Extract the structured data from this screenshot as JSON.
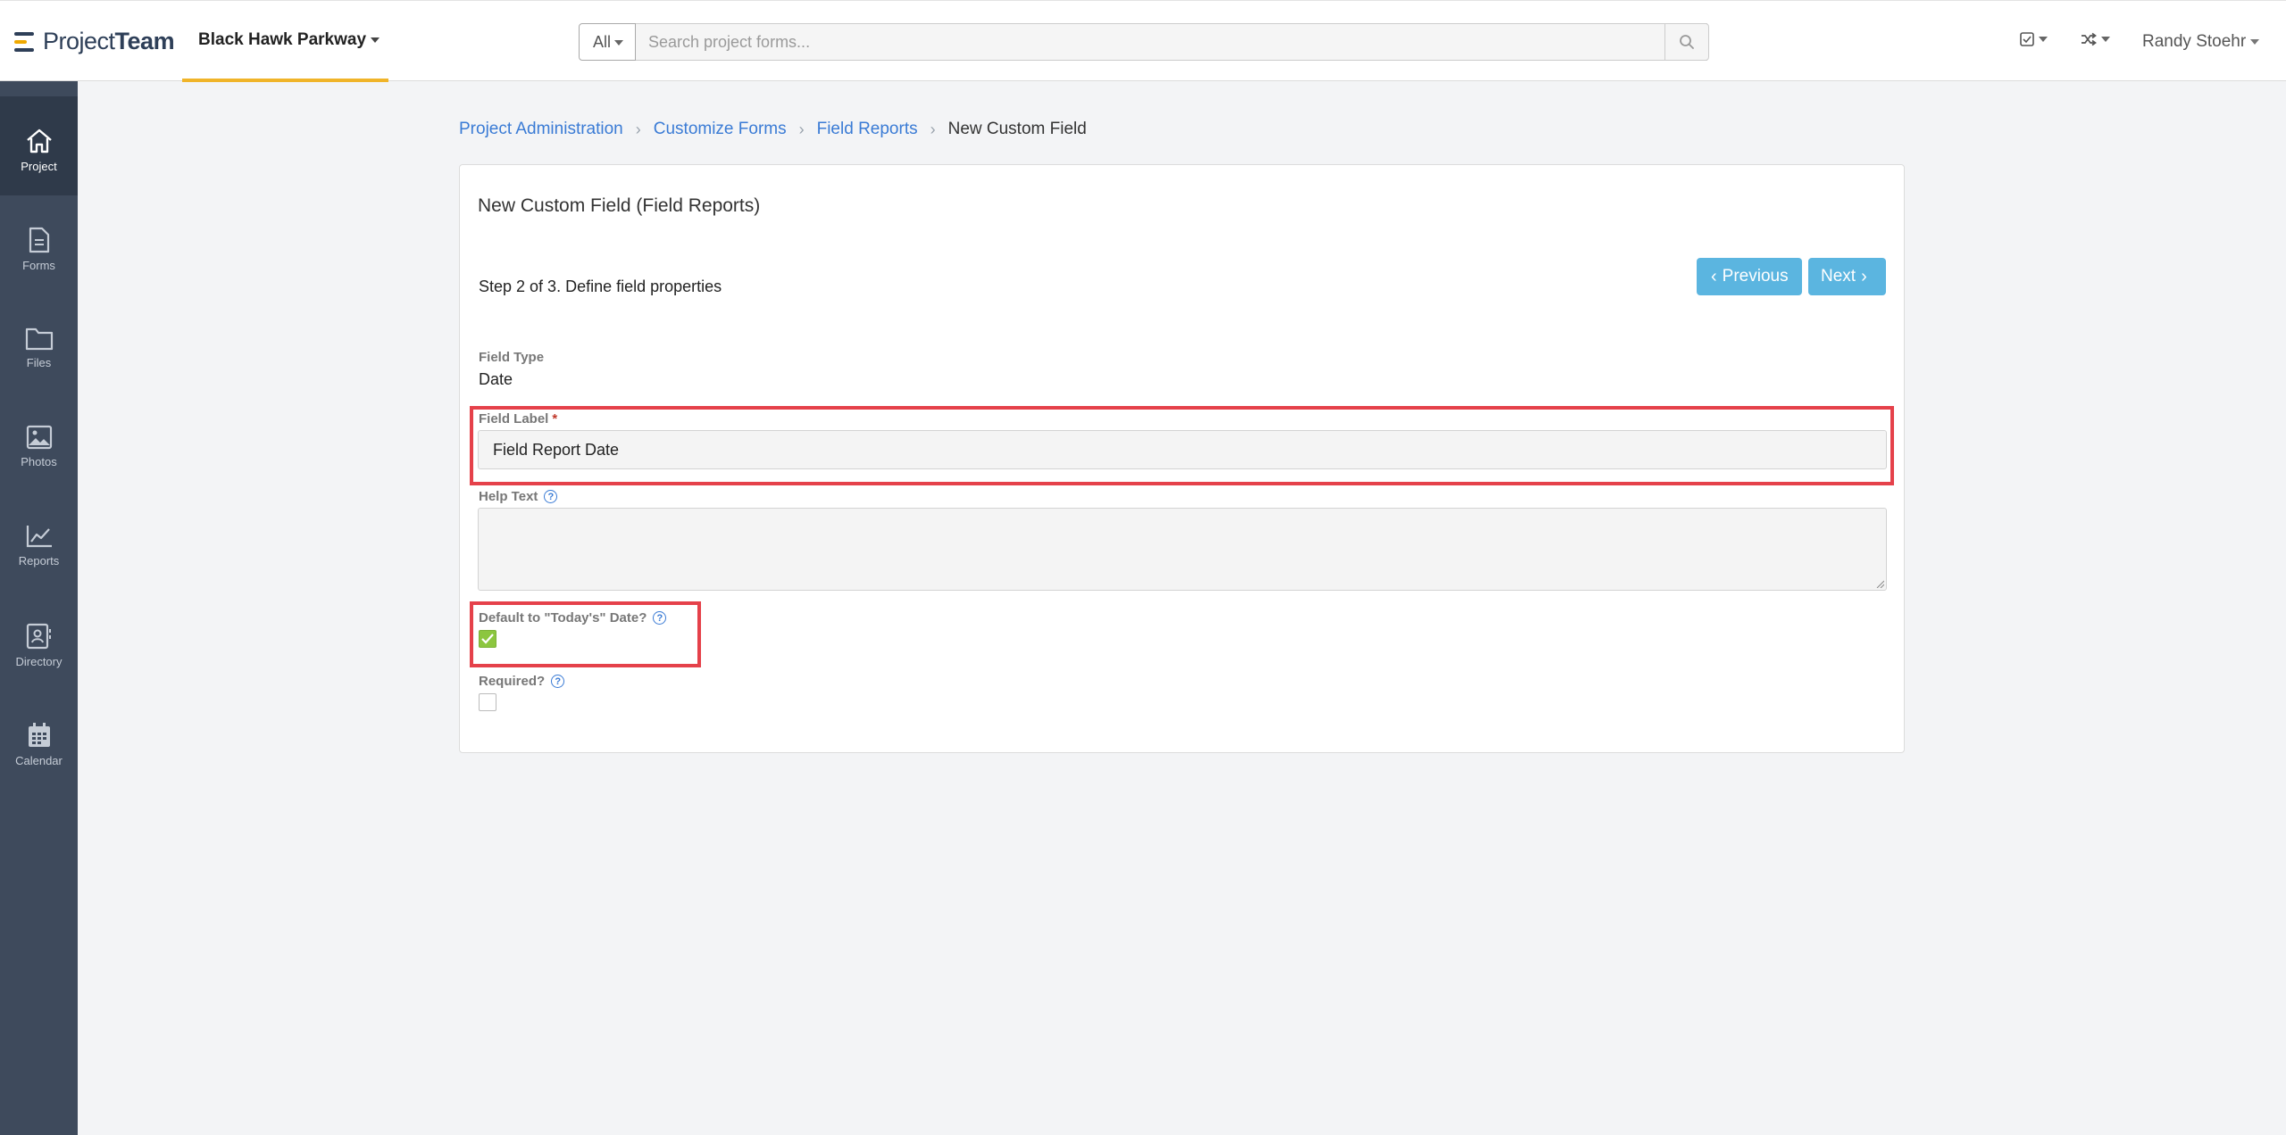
{
  "header": {
    "logo_text_light": "Project",
    "logo_text_bold": "Team",
    "project_name": "Black Hawk Parkway",
    "search": {
      "scope": "All",
      "placeholder": "Search project forms..."
    },
    "user_name": "Randy Stoehr"
  },
  "sidebar": {
    "items": [
      {
        "label": "Project",
        "icon": "home-icon",
        "active": true
      },
      {
        "label": "Forms",
        "icon": "document-icon"
      },
      {
        "label": "Files",
        "icon": "folder-icon"
      },
      {
        "label": "Photos",
        "icon": "image-icon"
      },
      {
        "label": "Reports",
        "icon": "chart-icon"
      },
      {
        "label": "Directory",
        "icon": "contact-book-icon"
      },
      {
        "label": "Calendar",
        "icon": "calendar-icon"
      }
    ]
  },
  "breadcrumb": {
    "items": [
      "Project Administration",
      "Customize Forms",
      "Field Reports"
    ],
    "current": "New Custom Field"
  },
  "card": {
    "title": "New Custom Field (Field Reports)",
    "step": "Step 2 of 3. Define field properties",
    "previous_label": "Previous",
    "next_label": "Next",
    "field_type_label": "Field Type",
    "field_type_value": "Date",
    "field_label_label": "Field Label",
    "field_label_required_mark": "*",
    "field_label_value": "Field Report Date",
    "help_text_label": "Help Text",
    "help_text_value": "",
    "default_today_label": "Default to \"Today's\" Date?",
    "default_today_checked": true,
    "required_label": "Required?",
    "required_checked": false
  },
  "colors": {
    "accent_blue": "#3a7bd5",
    "button_blue": "#5bb5e0",
    "sidebar_bg": "#3e4a5c",
    "checkbox_green": "#8cc63f",
    "highlight_red": "#e5414a",
    "project_underline": "#f0b429"
  }
}
